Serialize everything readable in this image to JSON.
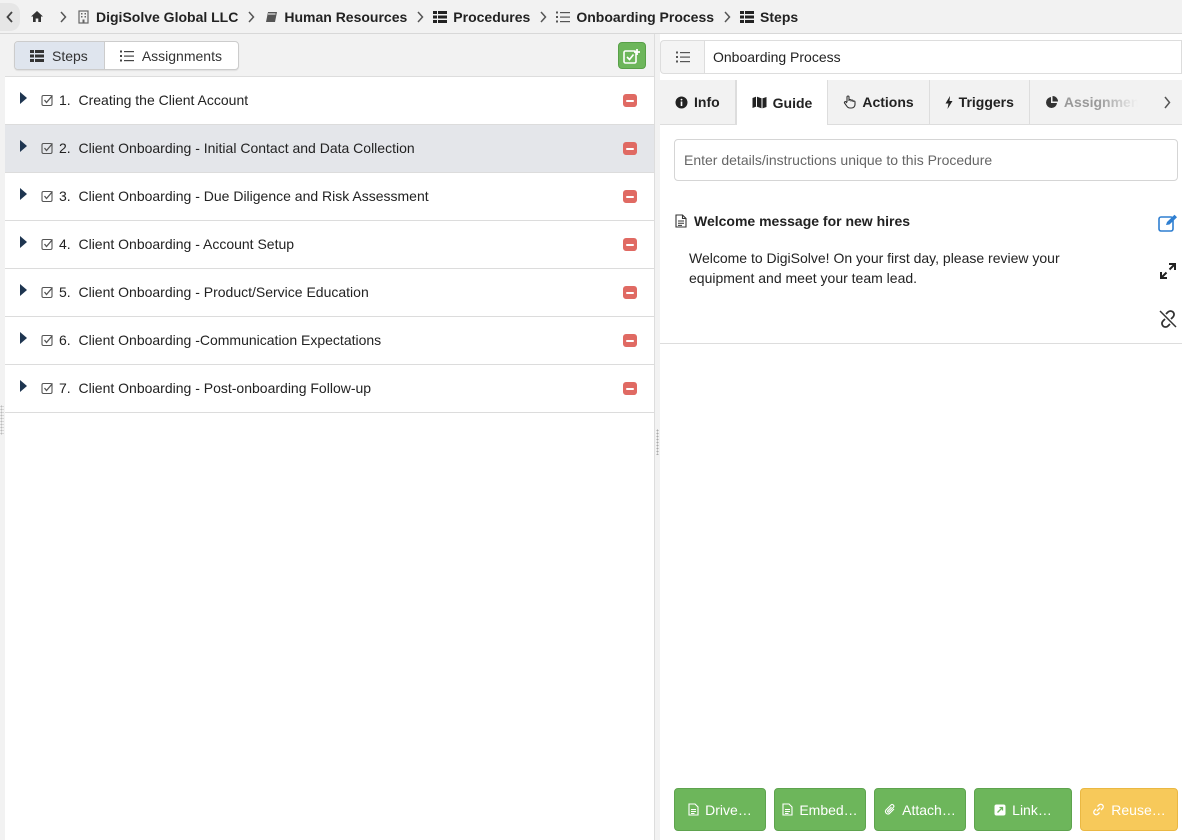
{
  "breadcrumb": {
    "items": [
      {
        "label": "DigiSolve Global LLC",
        "icon": "building-icon"
      },
      {
        "label": "Human Resources",
        "icon": "book-icon"
      },
      {
        "label": "Procedures",
        "icon": "table-list-icon"
      },
      {
        "label": "Onboarding Process",
        "icon": "list-ol-icon"
      },
      {
        "label": "Steps",
        "icon": "table-list-icon"
      }
    ]
  },
  "left": {
    "tabs": {
      "steps": "Steps",
      "assignments": "Assignments"
    },
    "steps": [
      {
        "number": "1.",
        "label": "Creating the Client Account"
      },
      {
        "number": "2.",
        "label": "Client Onboarding - Initial Contact and Data Collection"
      },
      {
        "number": "3.",
        "label": "Client Onboarding - Due Diligence and Risk Assessment"
      },
      {
        "number": "4.",
        "label": "Client Onboarding - Account Setup"
      },
      {
        "number": "5.",
        "label": "Client Onboarding - Product/Service Education"
      },
      {
        "number": "6.",
        "label": "Client Onboarding -Communication Expectations"
      },
      {
        "number": "7.",
        "label": "Client Onboarding - Post-onboarding Follow-up"
      }
    ],
    "selected_index": 1
  },
  "right": {
    "title": "Onboarding Process",
    "tabs": [
      "Info",
      "Guide",
      "Actions",
      "Triggers",
      "Assignment"
    ],
    "active_tab": "Guide",
    "details_placeholder": "Enter details/instructions unique to this Procedure",
    "guide": {
      "title": "Welcome message for new hires",
      "text": "Welcome to DigiSolve! On your first day, please review your equipment and meet your team lead."
    },
    "actions": [
      "Drive…",
      "Embed…",
      "Attach…",
      "Link…",
      "Reuse…"
    ]
  },
  "colors": {
    "accent_green": "#6db65b",
    "remove_red": "#e06a63",
    "reuse_yellow": "#f7c95a",
    "edit_blue": "#2f7fd1"
  }
}
